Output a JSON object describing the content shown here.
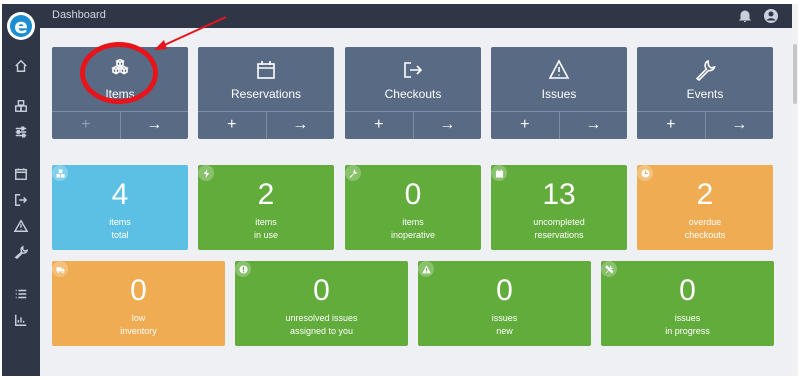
{
  "app": {
    "logo_letter": "e"
  },
  "topbar": {
    "title": "Dashboard",
    "icons": [
      "bell-icon",
      "user-icon"
    ]
  },
  "sidebar": {
    "icons": [
      "home-icon",
      "items-icon",
      "sliders-icon",
      "calendar-icon",
      "checkout-icon",
      "warning-icon",
      "wrench-icon",
      "list-icon",
      "chart-icon"
    ]
  },
  "nav_cards": [
    {
      "label": "Items",
      "icon": "cubes-icon",
      "add": "+",
      "go": "→",
      "add_disabled": true
    },
    {
      "label": "Reservations",
      "icon": "calendar-icon",
      "add": "+",
      "go": "→"
    },
    {
      "label": "Checkouts",
      "icon": "sign-out-icon",
      "add": "+",
      "go": "→"
    },
    {
      "label": "Issues",
      "icon": "warning-icon",
      "add": "+",
      "go": "→"
    },
    {
      "label": "Events",
      "icon": "wrench-icon",
      "add": "+",
      "go": "→"
    }
  ],
  "stats_row1": [
    {
      "value": "4",
      "line1": "items",
      "line2": "total",
      "color": "#5bc0e4",
      "icon": "cubes-icon"
    },
    {
      "value": "2",
      "line1": "items",
      "line2": "in use",
      "color": "#62ac3c",
      "icon": "bolt-icon"
    },
    {
      "value": "0",
      "line1": "items",
      "line2": "inoperative",
      "color": "#62ac3c",
      "icon": "wrench-icon"
    },
    {
      "value": "13",
      "line1": "uncompleted",
      "line2": "reservations",
      "color": "#62ac3c",
      "icon": "calendar-icon"
    },
    {
      "value": "2",
      "line1": "overdue",
      "line2": "checkouts",
      "color": "#f0ac52",
      "icon": "clock-icon"
    }
  ],
  "stats_row2": [
    {
      "value": "0",
      "line1": "low",
      "line2": "inventory",
      "color": "#f0ac52",
      "icon": "truck-icon"
    },
    {
      "value": "0",
      "line1": "unresolved issues",
      "line2": "assigned to you",
      "color": "#62ac3c",
      "icon": "exclamation-icon"
    },
    {
      "value": "0",
      "line1": "issues",
      "line2": "new",
      "color": "#62ac3c",
      "icon": "warning-icon"
    },
    {
      "value": "0",
      "line1": "issues",
      "line2": "in progress",
      "color": "#62ac3c",
      "icon": "tools-icon"
    }
  ]
}
